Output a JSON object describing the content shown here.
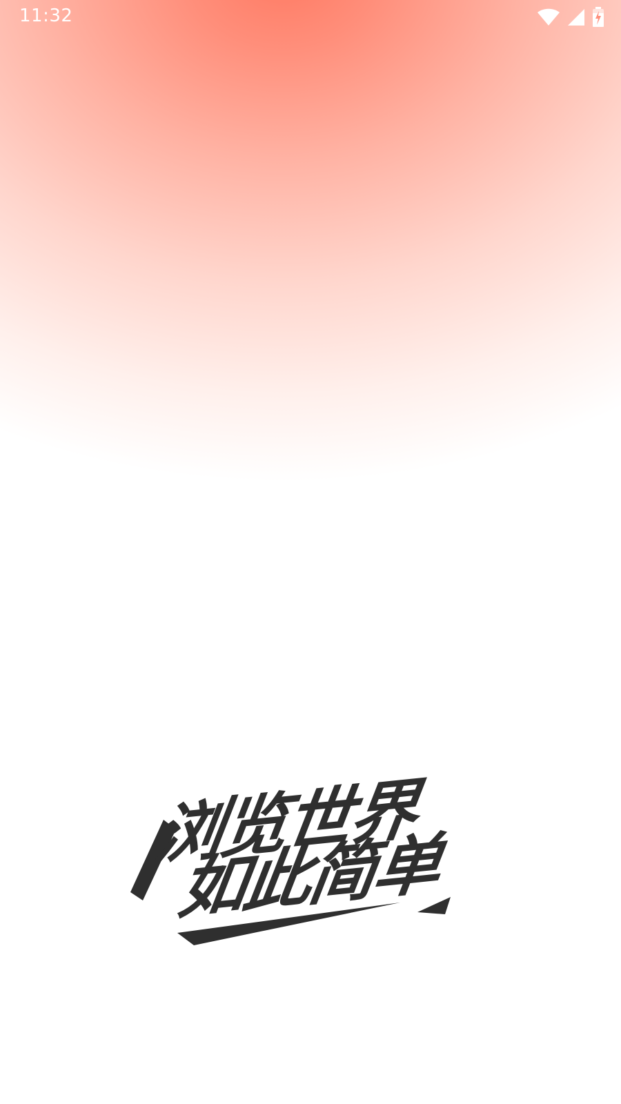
{
  "status_bar": {
    "time": "11:32",
    "icons": [
      "wifi-icon",
      "cell-signal-icon",
      "battery-charging-icon"
    ]
  },
  "splash": {
    "slogan_line_1": "浏览世界",
    "slogan_line_2": "如此简单"
  },
  "colors": {
    "gradient_top": "#ff7a63",
    "slogan_text": "#2f2f2f",
    "background": "#ffffff"
  }
}
